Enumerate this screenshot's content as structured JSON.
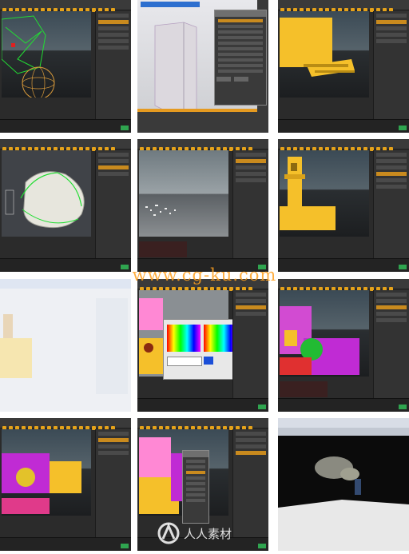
{
  "watermark": {
    "url_text": "www.cg-ku.com",
    "logo_text": "人人素材"
  },
  "colors": {
    "ui_dark": "#2b2b2b",
    "accent_orange": "#e5a21a",
    "selection_green": "#22dd33",
    "building_yellow": "#f5c02a",
    "fracture_magenta": "#c02bd4",
    "go_green": "#2fa44f"
  },
  "tiles": [
    {
      "id": "fracture-sphere-view",
      "content": "viewport with green wireframe chunks and orange sphere"
    },
    {
      "id": "material-dialog-view",
      "content": "tall box with properties dialog"
    },
    {
      "id": "yellow-building-blocks",
      "content": "yellow block geometry"
    },
    {
      "id": "rock-mesh-view",
      "content": "white rock mesh with green wireframe"
    },
    {
      "id": "particle-debris-view",
      "content": "debris particles over ground plane"
    },
    {
      "id": "tower-model-view",
      "content": "yellow tower model"
    },
    {
      "id": "faded-window-view",
      "content": "washed-out dialog window"
    },
    {
      "id": "color-picker-view",
      "content": "color picker dialog over building"
    },
    {
      "id": "multicolor-fracture-view",
      "content": "colored fracture pieces"
    },
    {
      "id": "tower-collapse-view",
      "content": "colored fracture collapse"
    },
    {
      "id": "fracture-with-panel-view",
      "content": "fracture with floating object panel"
    },
    {
      "id": "render-output-view",
      "content": "rendered dust cloud output"
    }
  ]
}
